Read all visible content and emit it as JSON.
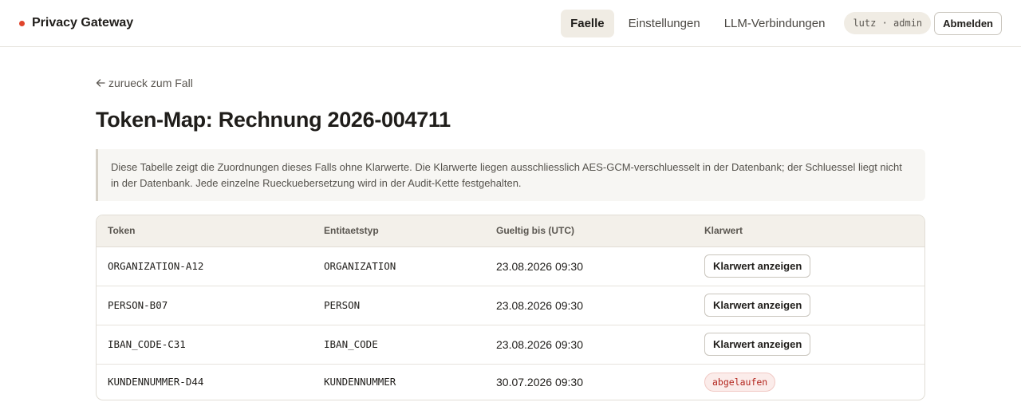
{
  "header": {
    "brand": "Privacy Gateway",
    "brand_color": "#e0452c",
    "nav": [
      {
        "label": "Faelle",
        "active": true
      },
      {
        "label": "Einstellungen",
        "active": false
      },
      {
        "label": "LLM-Verbindungen",
        "active": false
      }
    ],
    "user": "lutz · admin",
    "logout_label": "Abmelden"
  },
  "main": {
    "back_link": "zurueck zum Fall",
    "back_icon": "arrow-left-icon",
    "title": "Token-Map: Rechnung 2026-004711",
    "notice": "Diese Tabelle zeigt die Zuordnungen dieses Falls ohne Klarwerte. Die Klarwerte liegen ausschliesslich AES-GCM-verschluesselt in der Datenbank; der Schluessel liegt nicht in der Datenbank. Jede einzelne Rueckuebersetzung wird in der Audit-Kette festgehalten.",
    "table": {
      "columns": [
        "Token",
        "Entitaetstyp",
        "Gueltig bis (UTC)",
        "Klarwert"
      ],
      "rows": [
        {
          "token": "ORGANIZATION-A12",
          "type": "ORGANIZATION",
          "valid_until": "23.08.2026 09:30",
          "action": "Klarwert anzeigen",
          "expired": false
        },
        {
          "token": "PERSON-B07",
          "type": "PERSON",
          "valid_until": "23.08.2026 09:30",
          "action": "Klarwert anzeigen",
          "expired": false
        },
        {
          "token": "IBAN_CODE-C31",
          "type": "IBAN_CODE",
          "valid_until": "23.08.2026 09:30",
          "action": "Klarwert anzeigen",
          "expired": false
        },
        {
          "token": "KUNDENNUMMER-D44",
          "type": "KUNDENNUMMER",
          "valid_until": "30.07.2026 09:30",
          "action": "abgelaufen",
          "expired": true
        }
      ]
    }
  }
}
